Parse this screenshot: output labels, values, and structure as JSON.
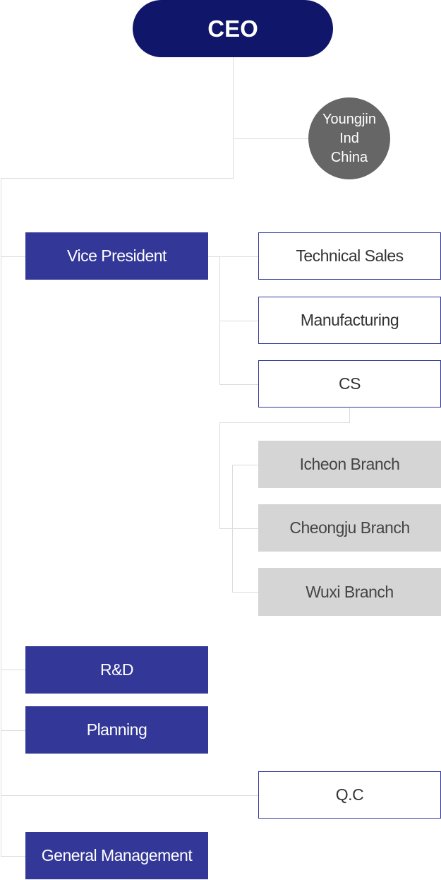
{
  "ceo": "CEO",
  "affiliate": "Youngjin\nInd\nChina",
  "vice_president": "Vice President",
  "vp_departments": [
    "Technical Sales",
    "Manufacturing",
    "CS"
  ],
  "cs_branches": [
    "Icheon Branch",
    "Cheongju Branch",
    "Wuxi Branch"
  ],
  "rnd": "R&D",
  "planning": "Planning",
  "qc": "Q.C",
  "general_management": "General Management",
  "colors": {
    "ceo": "#10166a",
    "primary": "#333797",
    "affiliate": "#666666",
    "branch": "#d5d5d5",
    "connector": "#dcdcdc"
  }
}
